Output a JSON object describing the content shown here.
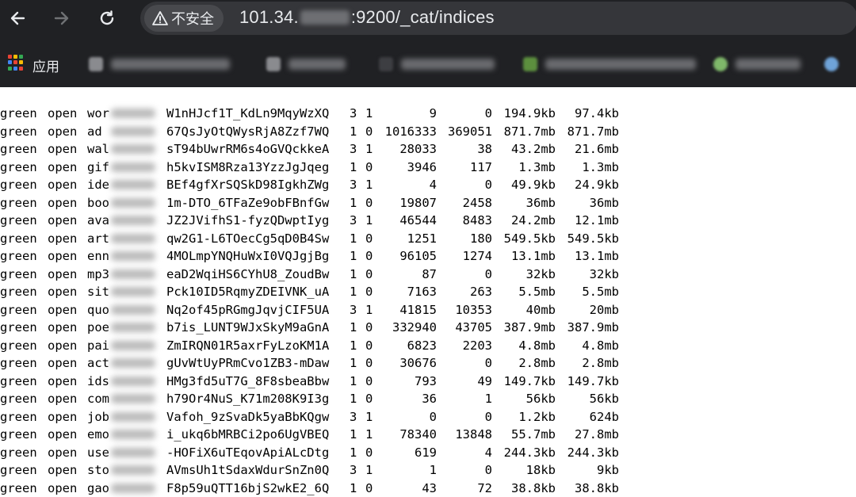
{
  "browser": {
    "back_icon": "arrow-left-icon",
    "forward_icon": "arrow-right-icon",
    "reload_icon": "reload-icon",
    "security_label": "不安全",
    "security_icon": "warning-triangle-icon",
    "url_host_prefix": "101.34.",
    "url_port_path": ":9200/_cat/indices",
    "apps_label": "应用",
    "apps_colors": [
      "#ea4335",
      "#fbbc04",
      "#34a853",
      "#4285f4",
      "#ea4335",
      "#fbbc04",
      "#34a853",
      "#4285f4",
      "#ea4335"
    ]
  },
  "indices": [
    {
      "health": "green",
      "status": "open",
      "index": "wor",
      "uuid": "W1nHJcf1T_KdLn9MqyWzXQ",
      "pri": "3",
      "rep": "1",
      "docs_count": "9",
      "docs_deleted": "0",
      "store_size": "194.9kb",
      "pri_store_size": "97.4kb"
    },
    {
      "health": "green",
      "status": "open",
      "index": "ad",
      "uuid": "67QsJyOtQWysRjA8Zzf7WQ",
      "pri": "1",
      "rep": "0",
      "docs_count": "1016333",
      "docs_deleted": "369051",
      "store_size": "871.7mb",
      "pri_store_size": "871.7mb"
    },
    {
      "health": "green",
      "status": "open",
      "index": "wal",
      "uuid": "sT94bUwrRM6s4oGVQckkeA",
      "pri": "3",
      "rep": "1",
      "docs_count": "28033",
      "docs_deleted": "38",
      "store_size": "43.2mb",
      "pri_store_size": "21.6mb"
    },
    {
      "health": "green",
      "status": "open",
      "index": "gif",
      "uuid": "h5kvISM8Rza13YzzJgJqeg",
      "pri": "1",
      "rep": "0",
      "docs_count": "3946",
      "docs_deleted": "117",
      "store_size": "1.3mb",
      "pri_store_size": "1.3mb"
    },
    {
      "health": "green",
      "status": "open",
      "index": "ide",
      "uuid": "BEf4gfXrSQSkD98IgkhZWg",
      "pri": "3",
      "rep": "1",
      "docs_count": "4",
      "docs_deleted": "0",
      "store_size": "49.9kb",
      "pri_store_size": "24.9kb"
    },
    {
      "health": "green",
      "status": "open",
      "index": "boo",
      "uuid": "1m-DTO_6TFaZe9obFBnfGw",
      "pri": "1",
      "rep": "0",
      "docs_count": "19807",
      "docs_deleted": "2458",
      "store_size": "36mb",
      "pri_store_size": "36mb"
    },
    {
      "health": "green",
      "status": "open",
      "index": "ava",
      "uuid": "JZ2JVifhS1-fyzQDwptIyg",
      "pri": "3",
      "rep": "1",
      "docs_count": "46544",
      "docs_deleted": "8483",
      "store_size": "24.2mb",
      "pri_store_size": "12.1mb"
    },
    {
      "health": "green",
      "status": "open",
      "index": "art",
      "uuid": "qw2G1-L6TOecCg5qD0B4Sw",
      "pri": "1",
      "rep": "0",
      "docs_count": "1251",
      "docs_deleted": "180",
      "store_size": "549.5kb",
      "pri_store_size": "549.5kb"
    },
    {
      "health": "green",
      "status": "open",
      "index": "enn",
      "uuid": "4MOLmpYNQHuWxI0VQJgjBg",
      "pri": "1",
      "rep": "0",
      "docs_count": "96105",
      "docs_deleted": "1274",
      "store_size": "13.1mb",
      "pri_store_size": "13.1mb"
    },
    {
      "health": "green",
      "status": "open",
      "index": "mp3",
      "uuid": "eaD2WqiHS6CYhU8_ZoudBw",
      "pri": "1",
      "rep": "0",
      "docs_count": "87",
      "docs_deleted": "0",
      "store_size": "32kb",
      "pri_store_size": "32kb"
    },
    {
      "health": "green",
      "status": "open",
      "index": "sit",
      "uuid": "Pck10ID5RqmyZDEIVNK_uA",
      "pri": "1",
      "rep": "0",
      "docs_count": "7163",
      "docs_deleted": "263",
      "store_size": "5.5mb",
      "pri_store_size": "5.5mb"
    },
    {
      "health": "green",
      "status": "open",
      "index": "quo",
      "uuid": "Nq2of45pRGmgJqvjCIF5UA",
      "pri": "3",
      "rep": "1",
      "docs_count": "41815",
      "docs_deleted": "10353",
      "store_size": "40mb",
      "pri_store_size": "20mb"
    },
    {
      "health": "green",
      "status": "open",
      "index": "poe",
      "uuid": "b7is_LUNT9WJxSkyM9aGnA",
      "pri": "1",
      "rep": "0",
      "docs_count": "332940",
      "docs_deleted": "43705",
      "store_size": "387.9mb",
      "pri_store_size": "387.9mb"
    },
    {
      "health": "green",
      "status": "open",
      "index": "pai",
      "uuid": "ZmIRQN01R5axrFyLzoKM1A",
      "pri": "1",
      "rep": "0",
      "docs_count": "6823",
      "docs_deleted": "2203",
      "store_size": "4.8mb",
      "pri_store_size": "4.8mb"
    },
    {
      "health": "green",
      "status": "open",
      "index": "act",
      "uuid": "gUvWtUyPRmCvo1ZB3-mDaw",
      "pri": "1",
      "rep": "0",
      "docs_count": "30676",
      "docs_deleted": "0",
      "store_size": "2.8mb",
      "pri_store_size": "2.8mb"
    },
    {
      "health": "green",
      "status": "open",
      "index": "ids",
      "uuid": "HMg3fd5uT7G_8F8sbeaBbw",
      "pri": "1",
      "rep": "0",
      "docs_count": "793",
      "docs_deleted": "49",
      "store_size": "149.7kb",
      "pri_store_size": "149.7kb"
    },
    {
      "health": "green",
      "status": "open",
      "index": "com",
      "uuid": "h79Or4NuS_K71m208K9I3g",
      "pri": "1",
      "rep": "0",
      "docs_count": "36",
      "docs_deleted": "1",
      "store_size": "56kb",
      "pri_store_size": "56kb"
    },
    {
      "health": "green",
      "status": "open",
      "index": "job",
      "uuid": "Vafoh_9zSvaDk5yaBbKQgw",
      "pri": "3",
      "rep": "1",
      "docs_count": "0",
      "docs_deleted": "0",
      "store_size": "1.2kb",
      "pri_store_size": "624b"
    },
    {
      "health": "green",
      "status": "open",
      "index": "emo",
      "uuid": "i_ukq6bMRBCi2po6UgVBEQ",
      "pri": "1",
      "rep": "1",
      "docs_count": "78340",
      "docs_deleted": "13848",
      "store_size": "55.7mb",
      "pri_store_size": "27.8mb"
    },
    {
      "health": "green",
      "status": "open",
      "index": "use",
      "uuid": "-HOFiX6uTEqovApiALcDtg",
      "pri": "1",
      "rep": "0",
      "docs_count": "619",
      "docs_deleted": "4",
      "store_size": "244.3kb",
      "pri_store_size": "244.3kb"
    },
    {
      "health": "green",
      "status": "open",
      "index": "sto",
      "uuid": "AVmsUh1tSdaxWdurSnZn0Q",
      "pri": "3",
      "rep": "1",
      "docs_count": "1",
      "docs_deleted": "0",
      "store_size": "18kb",
      "pri_store_size": "9kb"
    },
    {
      "health": "green",
      "status": "open",
      "index": "gao",
      "uuid": "F8p59uQTT16bjS2wkE2_6Q",
      "pri": "1",
      "rep": "0",
      "docs_count": "43",
      "docs_deleted": "72",
      "store_size": "38.8kb",
      "pri_store_size": "38.8kb"
    }
  ]
}
